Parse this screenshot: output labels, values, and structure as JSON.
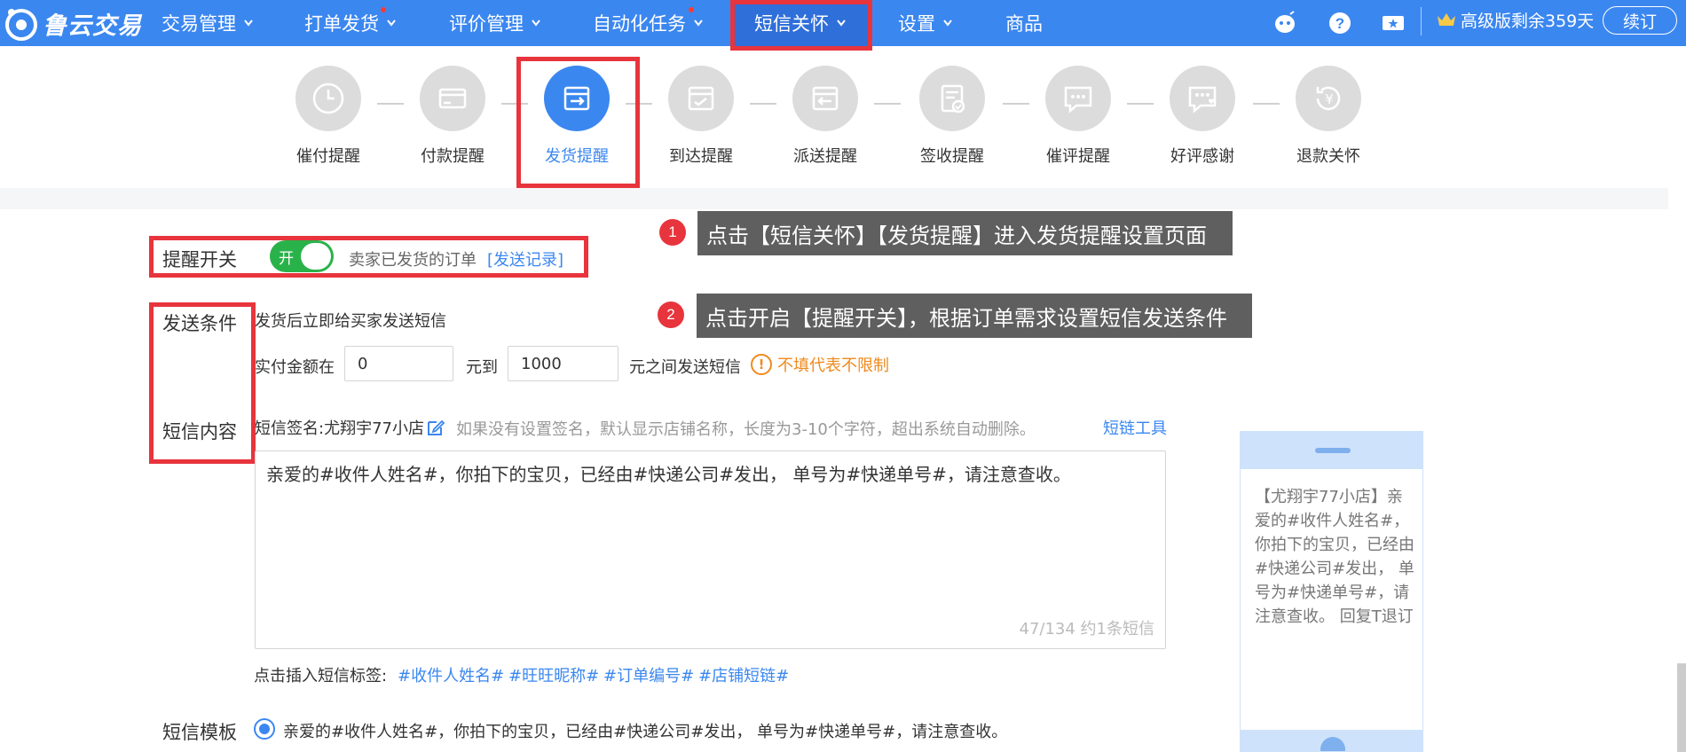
{
  "brand": {
    "name": "鲁云交易",
    "accent": "#3b87f0",
    "highlight": "#e8343c"
  },
  "nav": {
    "items": [
      {
        "label": "交易管理",
        "dropdown": true,
        "badge": false
      },
      {
        "label": "打单发货",
        "dropdown": true,
        "badge": true
      },
      {
        "label": "评价管理",
        "dropdown": true,
        "badge": false
      },
      {
        "label": "自动化任务",
        "dropdown": true,
        "badge": true
      },
      {
        "label": "短信关怀",
        "dropdown": true,
        "badge": false,
        "active": true
      },
      {
        "label": "设置",
        "dropdown": true,
        "badge": false
      },
      {
        "label": "商品",
        "dropdown": false,
        "badge": false
      }
    ],
    "right_icons": [
      "chat-bot-icon",
      "help-icon",
      "coupon-icon"
    ],
    "vip_text": "高级版剩余359天",
    "renew_label": "续订"
  },
  "steps": [
    {
      "label": "催付提醒",
      "icon": "clock-icon"
    },
    {
      "label": "付款提醒",
      "icon": "card-icon"
    },
    {
      "label": "发货提醒",
      "icon": "ship-box-icon",
      "active": true
    },
    {
      "label": "到达提醒",
      "icon": "arrive-box-icon"
    },
    {
      "label": "派送提醒",
      "icon": "deliver-box-icon"
    },
    {
      "label": "签收提醒",
      "icon": "sign-doc-icon"
    },
    {
      "label": "催评提醒",
      "icon": "comment-icon"
    },
    {
      "label": "好评感谢",
      "icon": "heart-comment-icon"
    },
    {
      "label": "退款关怀",
      "icon": "refund-icon"
    }
  ],
  "callouts": [
    {
      "num": "1",
      "text": "点击【短信关怀】【发货提醒】进入发货提醒设置页面"
    },
    {
      "num": "2",
      "text": "点击开启【提醒开关】，根据订单需求设置短信发送条件"
    }
  ],
  "form": {
    "switch": {
      "label": "提醒开关",
      "state_text": "开",
      "on": true,
      "desc": "卖家已发货的订单",
      "record_link": "[发送记录]"
    },
    "condition": {
      "label": "发送条件",
      "line1": "发货后立即给买家发送短信",
      "amount_prefix": "实付金额在",
      "min_value": "0",
      "mid": "元到",
      "max_value": "1000",
      "suffix": "元之间发送短信",
      "warning": "不填代表不限制"
    },
    "content": {
      "label": "短信内容",
      "signature": "短信签名:尤翔宇77小店",
      "signature_hint": "如果没有设置签名，默认显示店铺名称，长度为3-10个字符，超出系统自动删除。",
      "tool_link": "短链工具",
      "text": "亲爱的#收件人姓名#，你拍下的宝贝，已经由#快递公司#发出， 单号为#快递单号#，请注意查收。",
      "counter": "47/134  约1条短信",
      "insert_label": "点击插入短信标签:",
      "tags": [
        "#收件人姓名#",
        "#旺旺昵称#",
        "#订单编号#",
        "#店铺短链#"
      ]
    },
    "template": {
      "label": "短信模板",
      "option": "亲爱的#收件人姓名#，你拍下的宝贝，已经由#快递公司#发出， 单号为#快递单号#，请注意查收。"
    }
  },
  "preview": {
    "message": "【尤翔宇77小店】亲爱的#收件人姓名#，你拍下的宝贝，已经由#快递公司#发出， 单号为#快递单号#，请注意查收。 回复T退订"
  }
}
